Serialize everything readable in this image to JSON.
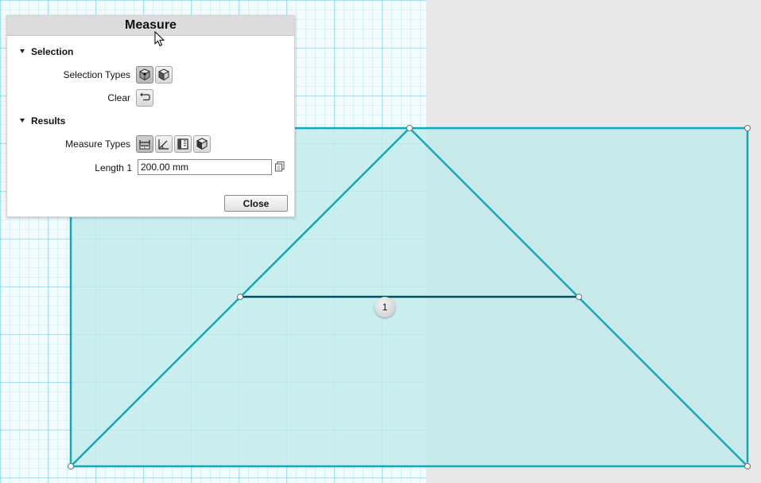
{
  "panel": {
    "title": "Measure",
    "selection_section": "Selection",
    "selection_types_label": "Selection Types",
    "clear_label": "Clear",
    "results_section": "Results",
    "measure_types_label": "Measure Types",
    "length_label": "Length 1",
    "length_value": "200.00 mm",
    "close_label": "Close"
  },
  "viewport": {
    "dimension_marker": "1",
    "fill_color": "#c2eaea",
    "edge_color": "#13a8b4",
    "dimension_line_color": "#005060",
    "grid_color": "#4cc4e6",
    "icons": [
      "vertex-handle-icon",
      "mouse-cursor-icon"
    ]
  }
}
